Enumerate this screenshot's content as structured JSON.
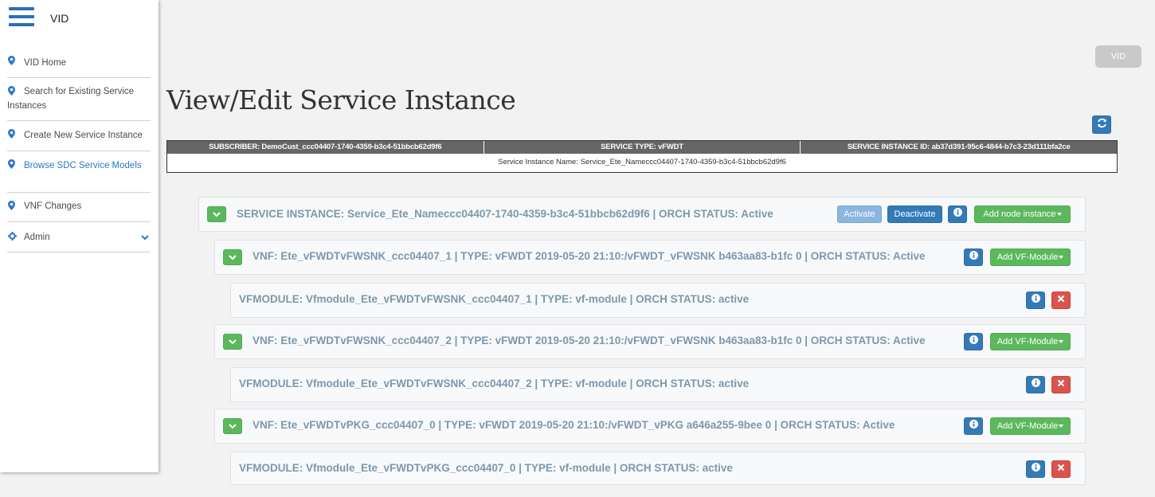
{
  "app": {
    "title": "VID"
  },
  "nav": [
    {
      "label": "VID Home"
    },
    {
      "label": "Search for Existing Service Instances"
    },
    {
      "label": "Create New Service Instance"
    },
    {
      "label": "Browse SDC Service Models"
    },
    {
      "label": "VNF Changes"
    },
    {
      "label": "Admin"
    }
  ],
  "header": {
    "vid_button": "VID"
  },
  "page": {
    "title": "View/Edit Service Instance"
  },
  "info": {
    "subscriber": "SUBSCRIBER: DemoCust_ccc04407-1740-4359-b3c4-51bbcb62d9f6",
    "service_type": "SERVICE TYPE: vFWDT",
    "service_instance_id": "SERVICE INSTANCE ID: ab37d391-95c6-4844-b7c3-23d111bfa2ce",
    "service_instance_name": "Service Instance Name: Service_Ete_Nameccc04407-1740-4359-b3c4-51bbcb62d9f6"
  },
  "tree": {
    "service": {
      "label": "SERVICE INSTANCE: Service_Ete_Nameccc04407-1740-4359-b3c4-51bbcb62d9f6 | ORCH STATUS: Active",
      "activate": "Activate",
      "deactivate": "Deactivate",
      "add_node": "Add node instance"
    },
    "rows": [
      {
        "label": "VNF: Ete_vFWDTvFWSNK_ccc04407_1 | TYPE: vFWDT 2019-05-20 21:10:/vFWDT_vFWSNK b463aa83-b1fc 0 | ORCH STATUS: Active",
        "add": "Add VF-Module"
      },
      {
        "label": "VFMODULE: Vfmodule_Ete_vFWDTvFWSNK_ccc04407_1 | TYPE: vf-module | ORCH STATUS: active"
      },
      {
        "label": "VNF: Ete_vFWDTvFWSNK_ccc04407_2 | TYPE: vFWDT 2019-05-20 21:10:/vFWDT_vFWSNK b463aa83-b1fc 0 | ORCH STATUS: Active",
        "add": "Add VF-Module"
      },
      {
        "label": "VFMODULE: Vfmodule_Ete_vFWDTvFWSNK_ccc04407_2 | TYPE: vf-module | ORCH STATUS: active"
      },
      {
        "label": "VNF: Ete_vFWDTvPKG_ccc04407_0 | TYPE: vFWDT 2019-05-20 21:10:/vFWDT_vPKG a646a255-9bee 0 | ORCH STATUS: Active",
        "add": "Add VF-Module"
      },
      {
        "label": "VFMODULE: Vfmodule_Ete_vFWDTvPKG_ccc04407_0 | TYPE: vf-module | ORCH STATUS: active"
      }
    ]
  },
  "colors": {
    "primary": "#337ab7",
    "success": "#5cb85c",
    "danger": "#d9534f",
    "label": "#7d97ac",
    "nav_active": "#2a78c8"
  }
}
